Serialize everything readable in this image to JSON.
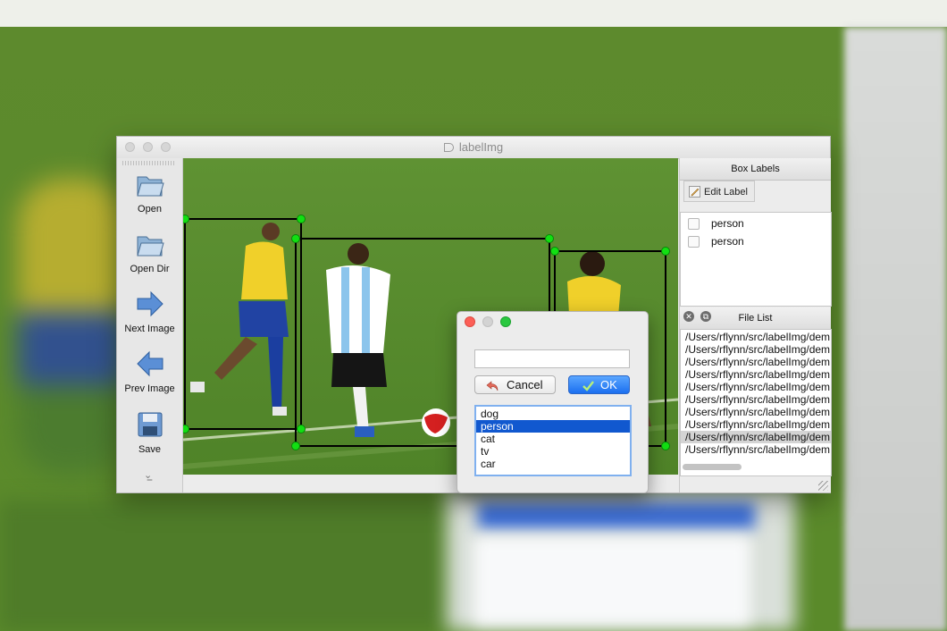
{
  "window": {
    "title": "labelImg"
  },
  "toolbar": {
    "items": [
      {
        "label": "Open",
        "icon": "folder-open-icon"
      },
      {
        "label": "Open Dir",
        "icon": "folder-open-icon"
      },
      {
        "label": "Next Image",
        "icon": "arrow-right-icon"
      },
      {
        "label": "Prev Image",
        "icon": "arrow-left-icon"
      },
      {
        "label": "Save",
        "icon": "floppy-disk-icon"
      }
    ],
    "more_icon": "double-chevron-down-icon"
  },
  "box_labels": {
    "title": "Box Labels",
    "edit_label": "Edit Label",
    "items": [
      {
        "label": "person",
        "checked": false
      },
      {
        "label": "person",
        "checked": false
      }
    ]
  },
  "file_list": {
    "title": "File List",
    "selected_index": 8,
    "items": [
      "/Users/rflynn/src/labelImg/dem",
      "/Users/rflynn/src/labelImg/dem",
      "/Users/rflynn/src/labelImg/dem",
      "/Users/rflynn/src/labelImg/dem",
      "/Users/rflynn/src/labelImg/dem",
      "/Users/rflynn/src/labelImg/dem",
      "/Users/rflynn/src/labelImg/dem",
      "/Users/rflynn/src/labelImg/dem",
      "/Users/rflynn/src/labelImg/dem",
      "/Users/rflynn/src/labelImg/dem"
    ]
  },
  "label_dialog": {
    "input_value": "",
    "cancel_label": "Cancel",
    "ok_label": "OK",
    "options": [
      "dog",
      "person",
      "cat",
      "tv",
      "car"
    ],
    "selected": "person"
  },
  "colors": {
    "box_outline": "#000000",
    "box_handle": "#00e000",
    "selection": "#1158cf",
    "ok_button": "#1b6ff0"
  }
}
